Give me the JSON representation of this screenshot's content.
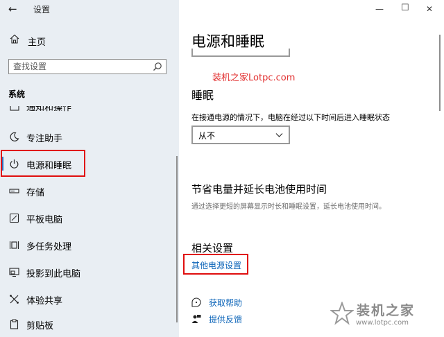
{
  "window": {
    "title": "设置",
    "back_glyph": "←",
    "minimize_glyph": "—",
    "maximize_glyph": "☐",
    "close_glyph": "✕"
  },
  "sidebar": {
    "home_label": "主页",
    "search_placeholder": "查找设置",
    "section_label": "系统",
    "clipped_item_label": "通知和操作",
    "items": [
      {
        "label": "专注助手",
        "icon": "moon-icon"
      },
      {
        "label": "电源和睡眠",
        "icon": "power-icon",
        "active": true
      },
      {
        "label": "存储",
        "icon": "storage-icon"
      },
      {
        "label": "平板电脑",
        "icon": "tablet-icon"
      },
      {
        "label": "多任务处理",
        "icon": "multitasking-icon"
      },
      {
        "label": "投影到此电脑",
        "icon": "projecting-icon"
      },
      {
        "label": "体验共享",
        "icon": "shared-experiences-icon"
      },
      {
        "label": "剪贴板",
        "icon": "clipboard-icon"
      }
    ]
  },
  "main": {
    "page_title": "电源和睡眠",
    "watermark": "装机之家Lotpc.com",
    "sleep_heading": "睡眠",
    "sleep_description": "在接通电源的情况下，电脑在经过以下时间后进入睡眠状态",
    "sleep_select_value": "从不",
    "battery_heading": "节省电量并延长电池使用时间",
    "battery_description": "通过选择更短的屏幕显示时长和睡眠设置，延长电池使用时间。",
    "related_heading": "相关设置",
    "related_link": "其他电源设置",
    "help_link": "获取帮助",
    "feedback_link": "提供反馈"
  },
  "brand_watermark": {
    "name": "装机之家",
    "url": "www.lotpc.com"
  },
  "colors": {
    "sidebar_bg": "#e9eef3",
    "accent": "#0a63b8",
    "highlight_box": "#e00d0d"
  }
}
